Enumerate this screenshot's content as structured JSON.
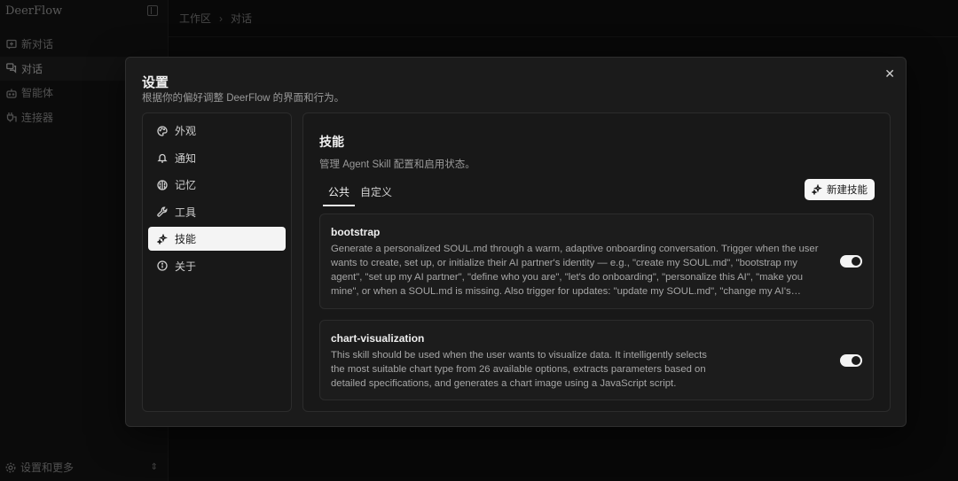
{
  "app": {
    "brand": "DeerFlow"
  },
  "sidebar": {
    "items": [
      {
        "label": "新对话",
        "icon": "new-chat-icon",
        "active": false
      },
      {
        "label": "对话",
        "icon": "chats-icon",
        "active": true
      },
      {
        "label": "智能体",
        "icon": "bot-icon",
        "active": false
      },
      {
        "label": "连接器",
        "icon": "plug-icon",
        "active": false
      }
    ],
    "settings_label": "设置和更多"
  },
  "breadcrumb": {
    "workspace": "工作区",
    "current": "对话"
  },
  "dialog": {
    "title": "设置",
    "subtitle": "根据你的偏好调整 DeerFlow 的界面和行为。",
    "menu": [
      {
        "label": "外观",
        "icon": "palette-icon"
      },
      {
        "label": "通知",
        "icon": "bell-icon"
      },
      {
        "label": "记忆",
        "icon": "brain-icon"
      },
      {
        "label": "工具",
        "icon": "wrench-icon"
      },
      {
        "label": "技能",
        "icon": "sparkles-icon",
        "active": true
      },
      {
        "label": "关于",
        "icon": "info-icon"
      }
    ],
    "section": {
      "title": "技能",
      "description": "管理 Agent Skill 配置和启用状态。",
      "tabs": [
        {
          "label": "公共",
          "active": true
        },
        {
          "label": "自定义",
          "active": false
        }
      ],
      "new_button": "新建技能",
      "skills": [
        {
          "name": "bootstrap",
          "description": "Generate a personalized SOUL.md through a warm, adaptive onboarding conversation. Trigger when the user wants to create, set up, or initialize their AI partner's identity — e.g., \"create my SOUL.md\", \"bootstrap my agent\", \"set up my AI partner\", \"define who you are\", \"let's do onboarding\", \"personalize this AI\", \"make you mine\", or when a SOUL.md is missing. Also trigger for updates: \"update my SOUL.md\", \"change my AI's personality\".",
          "enabled": true
        },
        {
          "name": "chart-visualization",
          "description": "This skill should be used when the user wants to visualize data. It intelligently selects the most suitable chart type from 26 available options, extracts parameters based on detailed specifications, and generates a chart image using a JavaScript script.",
          "enabled": true
        }
      ]
    }
  }
}
